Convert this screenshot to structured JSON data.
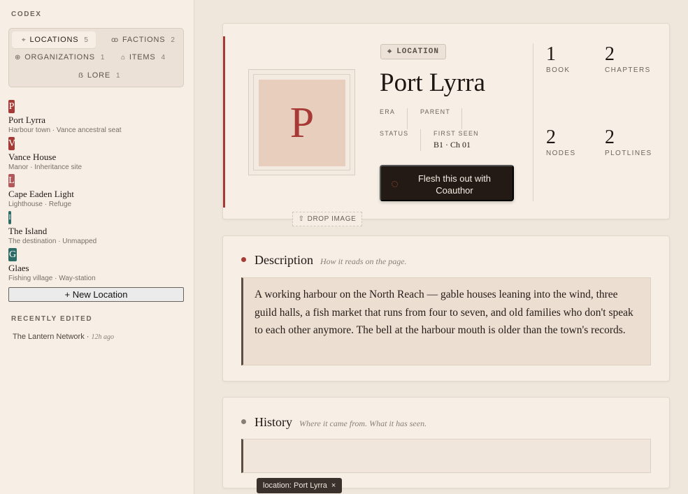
{
  "sidebar": {
    "heading": "CODEX",
    "tabs": [
      {
        "label": "LOCATIONS",
        "count": "5",
        "icon": "⌖"
      },
      {
        "label": "FACTIONS",
        "count": "2",
        "icon": "ꝏ"
      },
      {
        "label": "ORGANIZATIONS",
        "count": "1",
        "icon": "⊕"
      },
      {
        "label": "ITEMS",
        "count": "4",
        "icon": "⌂"
      },
      {
        "label": "LORE",
        "count": "1",
        "icon": "ẞ"
      }
    ],
    "locations": [
      {
        "initial": "P",
        "name": "Port Lyrra",
        "sub": "Harbour town · Vance ancestral seat",
        "color": "#a63a36"
      },
      {
        "initial": "V",
        "name": "Vance House",
        "sub": "Manor · Inheritance site",
        "color": "#a63a36"
      },
      {
        "initial": "L",
        "name": "Cape Eaden Light",
        "sub": "Lighthouse · Refuge",
        "color": "#b3585a"
      },
      {
        "initial": "I",
        "name": "The Island",
        "sub": "The destination · Unmapped",
        "color": "#2f6b66"
      },
      {
        "initial": "G",
        "name": "Glaes",
        "sub": "Fishing village · Way-station",
        "color": "#2f6b66"
      }
    ],
    "new_location_label": "+ New Location",
    "recent_heading": "RECENTLY EDITED",
    "recent_item": "The Lantern Network",
    "recent_ago": "12h ago"
  },
  "hero": {
    "image_initial": "P",
    "drop_label": "DROP IMAGE",
    "type_label": "LOCATION",
    "title": "Port Lyrra",
    "era_label": "ERA",
    "parent_label": "PARENT",
    "status_label": "STATUS",
    "first_seen_label": "FIRST SEEN",
    "first_seen_value": "B1 · Ch 01",
    "cta_label": "Flesh this out with Coauthor",
    "stats": [
      {
        "num": "1",
        "label": "BOOK"
      },
      {
        "num": "2",
        "label": "CHAPTERS"
      },
      {
        "num": "2",
        "label": "NODES"
      },
      {
        "num": "2",
        "label": "PLOTLINES"
      }
    ]
  },
  "description": {
    "title": "Description",
    "hint": "How it reads on the page.",
    "text": "A working harbour on the North Reach — gable houses leaning into the wind, three guild halls, a fish market that runs from four to seven, and old families who don't speak to each other anymore. The bell at the harbour mouth is older than the town's records."
  },
  "history": {
    "title": "History",
    "hint": "Where it came from. What it has seen.",
    "text": ""
  },
  "tooltip": {
    "label": "location: Port Lyrra",
    "close": "×"
  },
  "colors": {
    "accent": "#a63a36",
    "dark": "#241a15"
  }
}
